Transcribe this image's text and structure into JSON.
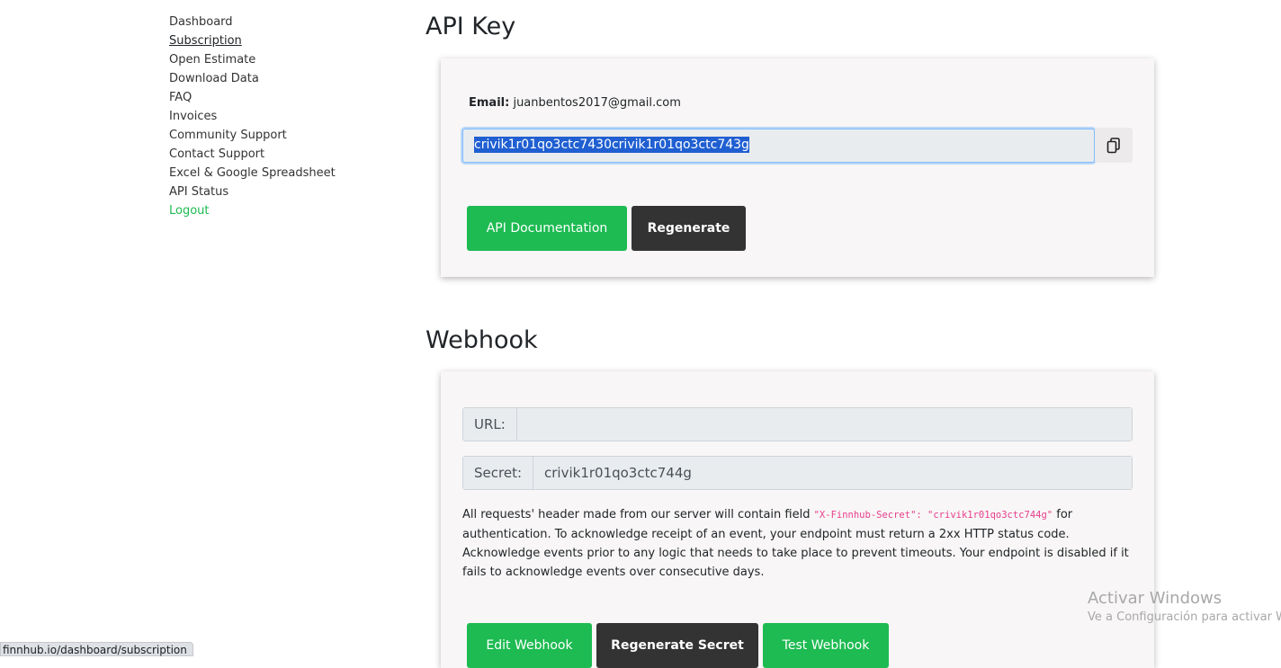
{
  "sidebar": {
    "items": [
      {
        "label": "Dashboard"
      },
      {
        "label": "Subscription"
      },
      {
        "label": "Open Estimate"
      },
      {
        "label": "Download Data"
      },
      {
        "label": "FAQ"
      },
      {
        "label": "Invoices"
      },
      {
        "label": "Community Support"
      },
      {
        "label": "Contact Support"
      },
      {
        "label": "Excel & Google Spreadsheet"
      },
      {
        "label": "API Status"
      },
      {
        "label": "Logout"
      }
    ],
    "active": "Subscription"
  },
  "api_key": {
    "heading": "API Key",
    "email_label": "Email:",
    "email_value": "juanbentos2017@gmail.com",
    "key_value": "crivik1r01qo3ctc7430crivik1r01qo3ctc743g",
    "copy_icon": "copy-icon",
    "docs_button": "API Documentation",
    "regenerate_button": "Regenerate"
  },
  "webhook": {
    "heading": "Webhook",
    "url_label": "URL:",
    "url_value": "",
    "secret_label": "Secret:",
    "secret_value": "crivik1r01qo3ctc744g",
    "desc_before": "All requests' header made from our server will contain field ",
    "desc_code": "\"X-Finnhub-Secret\": \"crivik1r01qo3ctc744g\"",
    "desc_after": " for authentication. To acknowledge receipt of an event, your endpoint must return a 2xx HTTP status code. Acknowledge events prior to any logic that needs to take place to prevent timeouts. Your endpoint is disabled if it fails to acknowledge events over consecutive days.",
    "edit_button": "Edit Webhook",
    "regenerate_secret_button": "Regenerate Secret",
    "test_button": "Test Webhook"
  },
  "watermark": {
    "line1": "Activar Windows",
    "line2": "Ve a Configuración para activar Windows."
  },
  "status_bar": {
    "url": "finnhub.io/dashboard/subscription"
  },
  "colors": {
    "accent_green": "#1dbb52",
    "dark_button": "#333333",
    "selection": "#1f5fd1",
    "code_pink": "#e83e8c"
  }
}
